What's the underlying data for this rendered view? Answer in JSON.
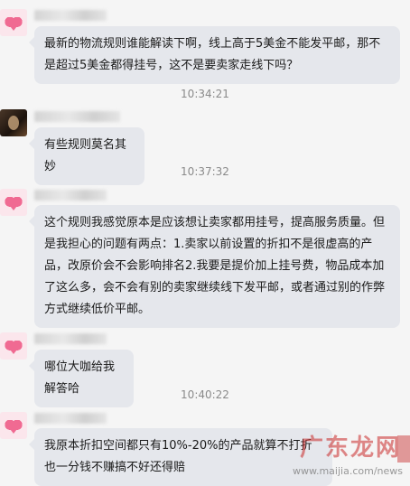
{
  "messages": [
    {
      "type": "message",
      "avatar": "pink-heart-avatar",
      "text": "最新的物流规则谁能解读下啊，线上高于5美金不能发平邮，那不是超过5美金都得挂号，这不是要卖家走线下吗？"
    },
    {
      "type": "timestamp",
      "text": "10:34:21"
    },
    {
      "type": "message",
      "avatar": "dark-photo-avatar",
      "text": "有些规则莫名其妙"
    },
    {
      "type": "timestamp",
      "text": "10:37:32"
    },
    {
      "type": "message",
      "avatar": "pink-heart-avatar",
      "text": "这个规则我感觉原本是应该想让卖家都用挂号，提高服务质量。但是我担心的问题有两点：1.卖家以前设置的折扣不是很虚高的产品，改原价会不会影响排名2.我要是提价加上挂号费，物品成本加了这么多，会不会有别的卖家继续线下发平邮，或者通过别的作弊方式继续低价平邮。"
    },
    {
      "type": "message",
      "avatar": "pink-heart-avatar",
      "text": "哪位大咖给我解答哈"
    },
    {
      "type": "timestamp",
      "text": "10:40:22"
    },
    {
      "type": "message",
      "avatar": "pink-heart-avatar",
      "text": "我原本折扣空间都只有10%-20%的产品就算不打折也一分钱不赚搞不好还得赔"
    }
  ],
  "watermark": {
    "main": "广东龙网",
    "url": "www.maijia.com/news"
  },
  "colors": {
    "bubble": "#e5e7ec",
    "background": "#f5f5f5",
    "timestamp": "#8a8a8a"
  }
}
